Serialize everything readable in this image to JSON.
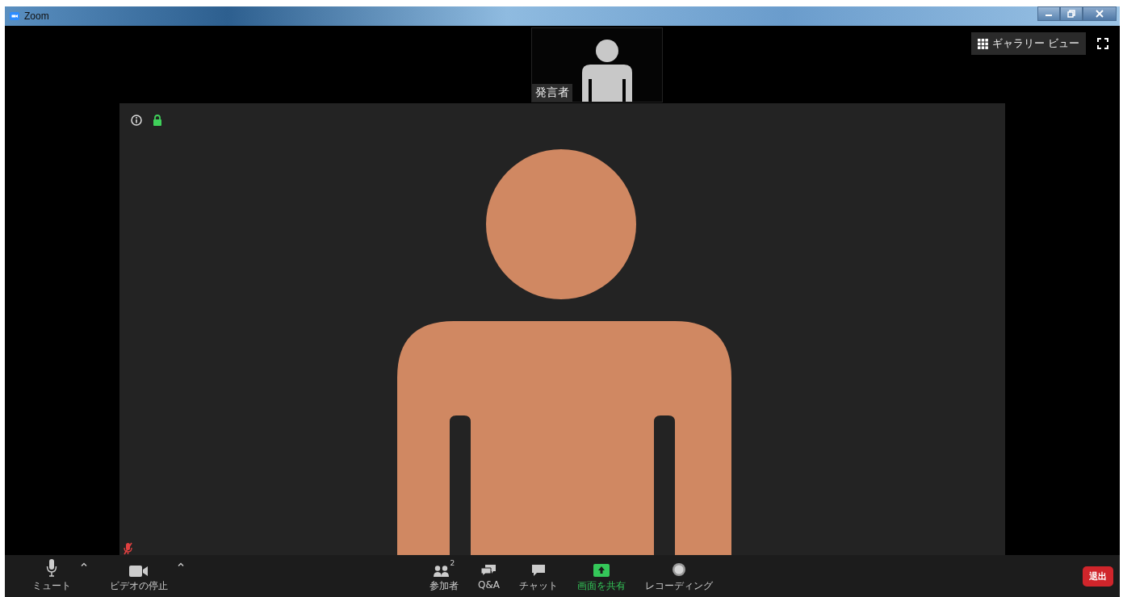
{
  "window": {
    "title": "Zoom"
  },
  "speaker_thumbnail": {
    "label": "発言者"
  },
  "view_button": {
    "label": "ギャラリー ビュー"
  },
  "main_video": {
    "muted": true
  },
  "toolbar": {
    "left": [
      {
        "kind": "mic",
        "label": "ミュート",
        "menu": true
      },
      {
        "kind": "video",
        "label": "ビデオの停止",
        "menu": true
      }
    ],
    "center": [
      {
        "kind": "participants",
        "label": "参加者",
        "count": "2",
        "active": false
      },
      {
        "kind": "qa",
        "label": "Q&A",
        "active": false
      },
      {
        "kind": "chat",
        "label": "チャット",
        "active": false
      },
      {
        "kind": "share",
        "label": "画面を共有",
        "active": true
      },
      {
        "kind": "record",
        "label": "レコーディング",
        "active": false
      }
    ],
    "leave_button": {
      "label": "退出"
    }
  }
}
